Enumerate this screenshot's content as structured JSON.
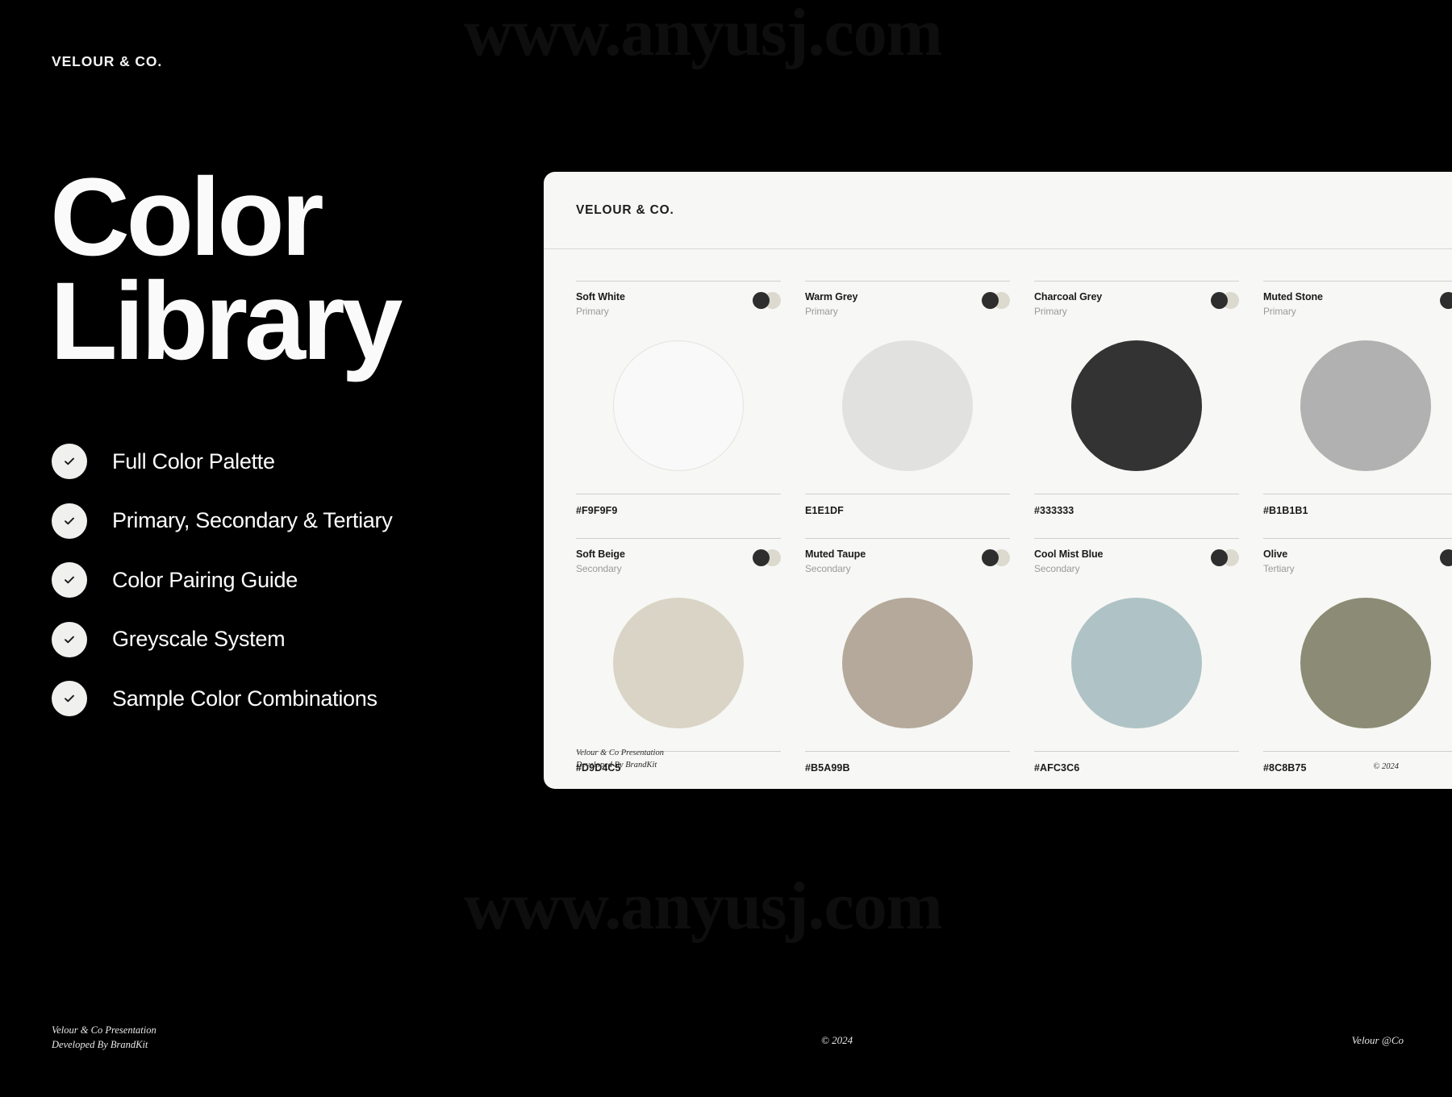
{
  "watermark": {
    "text": "www.anyusj.com"
  },
  "brand": {
    "logo": "VELOUR & CO."
  },
  "hero": {
    "line1": "Color",
    "line2": "Library"
  },
  "features": [
    {
      "label": "Full Color Palette"
    },
    {
      "label": "Primary, Secondary & Tertiary"
    },
    {
      "label": "Color Pairing Guide"
    },
    {
      "label": "Greyscale System"
    },
    {
      "label": "Sample Color Combinations"
    }
  ],
  "footer": {
    "left_line1": "Velour & Co Presentation",
    "left_line2": "Developed By BrandKit",
    "center": "© 2024",
    "right": "Velour @Co"
  },
  "panel": {
    "logo": "VELOUR & CO.",
    "footer_line1": "Velour & Co Presentation",
    "footer_line2": "Developed By BrandKit",
    "footer_right": "© 2024",
    "swatches": [
      {
        "name": "Soft White",
        "tier": "Primary",
        "hex": "#F9F9F9",
        "swatch_color": "#F9F9F9",
        "border": "1px solid #e3e3e0"
      },
      {
        "name": "Warm Grey",
        "tier": "Primary",
        "hex": "E1E1DF",
        "swatch_color": "#E1E1DF",
        "border": "none"
      },
      {
        "name": "Charcoal Grey",
        "tier": "Primary",
        "hex": "#333333",
        "swatch_color": "#333333",
        "border": "none"
      },
      {
        "name": "Muted Stone",
        "tier": "Primary",
        "hex": "#B1B1B1",
        "swatch_color": "#B1B1B1",
        "border": "none"
      },
      {
        "name": "Soft Beige",
        "tier": "Secondary",
        "hex": "#D9D4C5",
        "swatch_color": "#D9D4C5",
        "border": "none"
      },
      {
        "name": "Muted Taupe",
        "tier": "Secondary",
        "hex": "#B5A99B",
        "swatch_color": "#B5A99B",
        "border": "none"
      },
      {
        "name": "Cool Mist Blue",
        "tier": "Secondary",
        "hex": "#AFC3C6",
        "swatch_color": "#AFC3C6",
        "border": "none"
      },
      {
        "name": "Olive",
        "tier": "Tertiary",
        "hex": "#8C8B75",
        "swatch_color": "#8C8B75",
        "border": "none"
      }
    ]
  }
}
